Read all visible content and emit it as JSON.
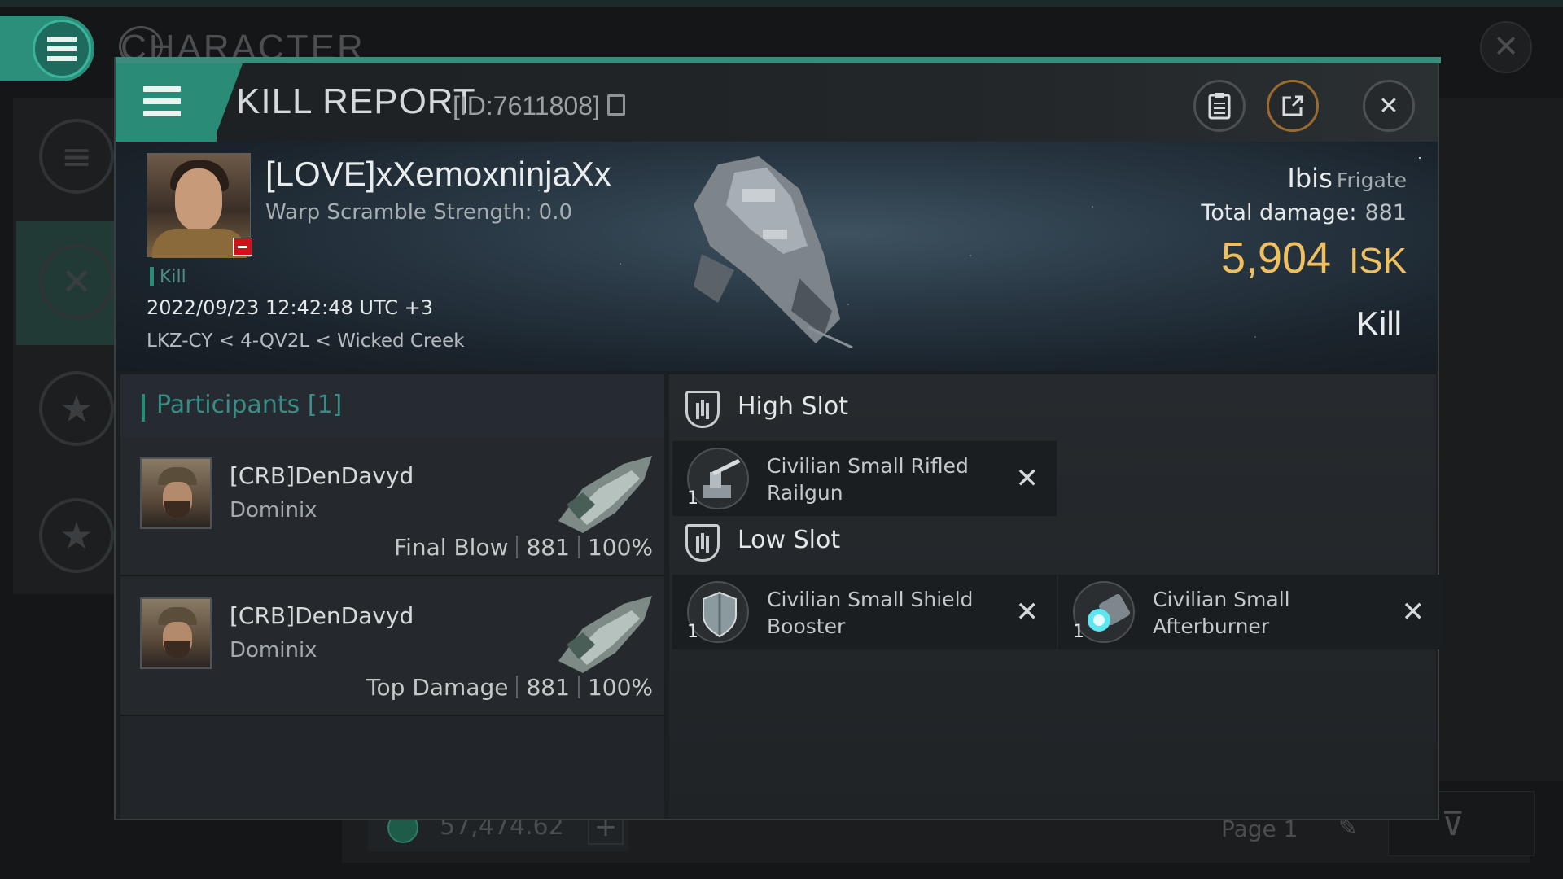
{
  "background": {
    "title": "CHARACTER",
    "wallet_value": "57,474.62",
    "page_label": "Page 1"
  },
  "header": {
    "title": "KILL REPORT",
    "id_label": "[ID:7611808]"
  },
  "victim": {
    "name": "[LOVE]xXemoxninjaXx",
    "warp_scramble": "Warp Scramble Strength: 0.0",
    "kill_tag": "Kill",
    "datetime": "2022/09/23 12:42:48 UTC +3",
    "location": "LKZ-CY < 4-QV2L < Wicked Creek",
    "ship_name": "Ibis",
    "ship_class": "Frigate",
    "total_damage_label": "Total damage:",
    "total_damage": "881",
    "isk_value": "5,904",
    "isk_unit": "ISK",
    "result": "Kill"
  },
  "participants": {
    "header": "Participants [1]",
    "rows": [
      {
        "name": "[CRB]DenDavyd",
        "ship": "Dominix",
        "role": "Final Blow",
        "damage": "881",
        "percent": "100%"
      },
      {
        "name": "[CRB]DenDavyd",
        "ship": "Dominix",
        "role": "Top Damage",
        "damage": "881",
        "percent": "100%"
      }
    ]
  },
  "fitting": {
    "high_slot": {
      "label": "High Slot",
      "modules": [
        {
          "name": "Civilian Small Rifled Railgun",
          "qty": "1",
          "icon": "railgun-icon"
        }
      ]
    },
    "low_slot": {
      "label": "Low Slot",
      "modules": [
        {
          "name": "Civilian Small Shield Booster",
          "qty": "1",
          "icon": "shield-booster-icon"
        },
        {
          "name": "Civilian Small Afterburner",
          "qty": "1",
          "icon": "afterburner-icon"
        }
      ]
    }
  },
  "colors": {
    "accent": "#2a8b76",
    "isk": "#f0c060",
    "victim_badge": "#d0101a"
  }
}
